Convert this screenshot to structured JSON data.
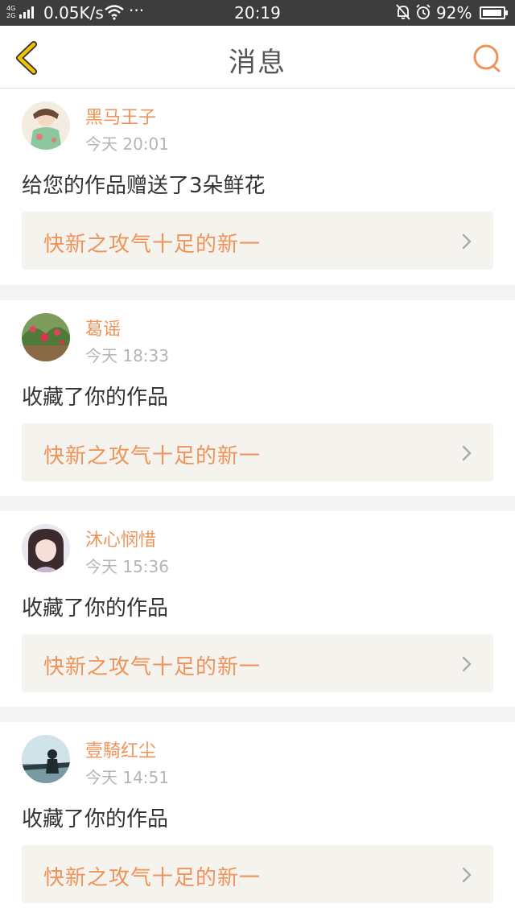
{
  "status_bar": {
    "network_top": "4G",
    "network_bottom": "2G",
    "speed": "0.05K/s",
    "more": "···",
    "time": "20:19",
    "battery": "92%",
    "battery_level": 0.92
  },
  "header": {
    "title": "消息",
    "back_icon": "back-chevron-icon",
    "search_icon": "search-icon"
  },
  "colors": {
    "accent": "#f0935a",
    "back_icon": "#f2c200",
    "name_text": "#f0935a",
    "time_text": "#b5b5b5",
    "body_text": "#333333",
    "link_bg": "#f4f3ee"
  },
  "messages": [
    {
      "user": "黑马王子",
      "time": "今天 20:01",
      "action": "给您的作品赠送了3朵鲜花",
      "work": "快新之攻气十足的新一"
    },
    {
      "user": "葛谣",
      "time": "今天 18:33",
      "action": "收藏了你的作品",
      "work": "快新之攻气十足的新一"
    },
    {
      "user": "沐心悯惜",
      "time": "今天 15:36",
      "action": "收藏了你的作品",
      "work": "快新之攻气十足的新一"
    },
    {
      "user": "壹騎红尘",
      "time": "今天 14:51",
      "action": "收藏了你的作品",
      "work": "快新之攻气十足的新一"
    }
  ]
}
